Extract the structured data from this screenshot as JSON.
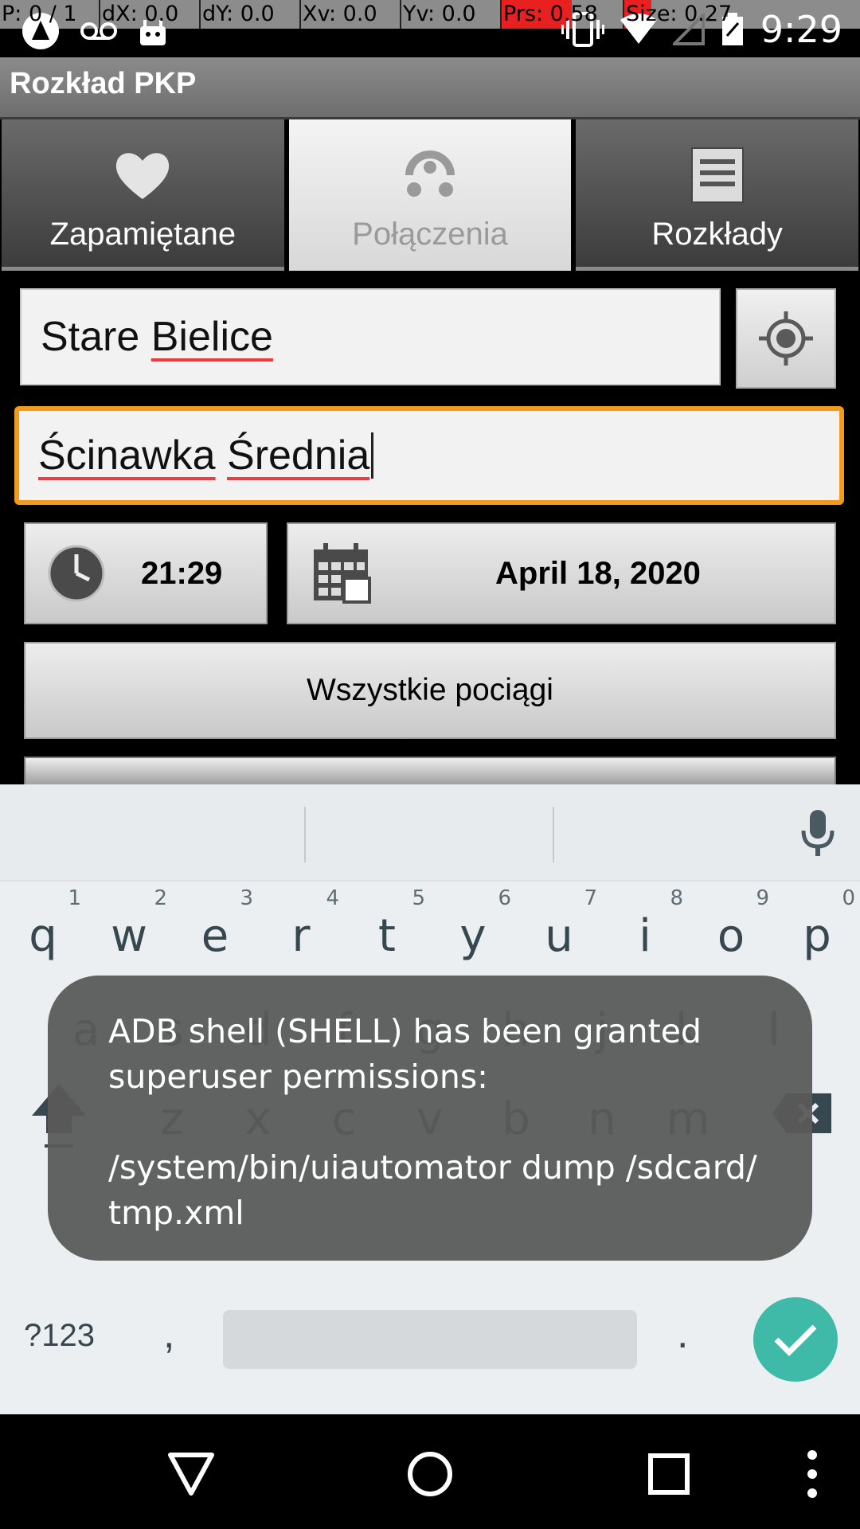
{
  "debug_bar": {
    "p": "P: 0 / 1",
    "dx": "dX: 0.0",
    "dy": "dY: 0.0",
    "xv": "Xv: 0.0",
    "yv": "Yv: 0.0",
    "prs": "Prs: 0.58",
    "size": "Size: 0.27"
  },
  "status_bar": {
    "time": "9:29",
    "icons": [
      "notification-app-icon",
      "voicemail-icon",
      "android-icon",
      "vibrate-icon",
      "wifi-icon",
      "signal-icon",
      "battery-icon"
    ]
  },
  "app": {
    "title": "Rozkład PKP"
  },
  "tabs": [
    {
      "label": "Zapamiętane",
      "icon": "heart-icon",
      "active": false
    },
    {
      "label": "Połączenia",
      "icon": "connections-icon",
      "active": true
    },
    {
      "label": "Rozkłady",
      "icon": "list-icon",
      "active": false
    }
  ],
  "form": {
    "from_word1": "Stare",
    "from_word2": "Bielice",
    "to_word1": "Ścinawka",
    "to_word2": "Średnia",
    "time": "21:29",
    "date": "April 18, 2020",
    "trains_button": "Wszystkie pociągi"
  },
  "keyboard": {
    "row1": [
      {
        "ch": "q",
        "hint": "1"
      },
      {
        "ch": "w",
        "hint": "2"
      },
      {
        "ch": "e",
        "hint": "3"
      },
      {
        "ch": "r",
        "hint": "4"
      },
      {
        "ch": "t",
        "hint": "5"
      },
      {
        "ch": "y",
        "hint": "6"
      },
      {
        "ch": "u",
        "hint": "7"
      },
      {
        "ch": "i",
        "hint": "8"
      },
      {
        "ch": "o",
        "hint": "9"
      },
      {
        "ch": "p",
        "hint": "0"
      }
    ],
    "row2": [
      "a",
      "s",
      "d",
      "f",
      "g",
      "h",
      "j",
      "k",
      "l"
    ],
    "row3": [
      "z",
      "x",
      "c",
      "v",
      "b",
      "n",
      "m"
    ],
    "symbols_key": "?123",
    "comma_key": ",",
    "period_key": "."
  },
  "toast": {
    "message": "ADB shell (SHELL) has been granted superuser permissions:\n\n/system/bin/uiautomator dump /sdcard/\ntmp.xml"
  },
  "colors": {
    "focus_border": "#f39a1c",
    "enter_key": "#3fbaa8",
    "debug_highlight": "#e8201f"
  }
}
